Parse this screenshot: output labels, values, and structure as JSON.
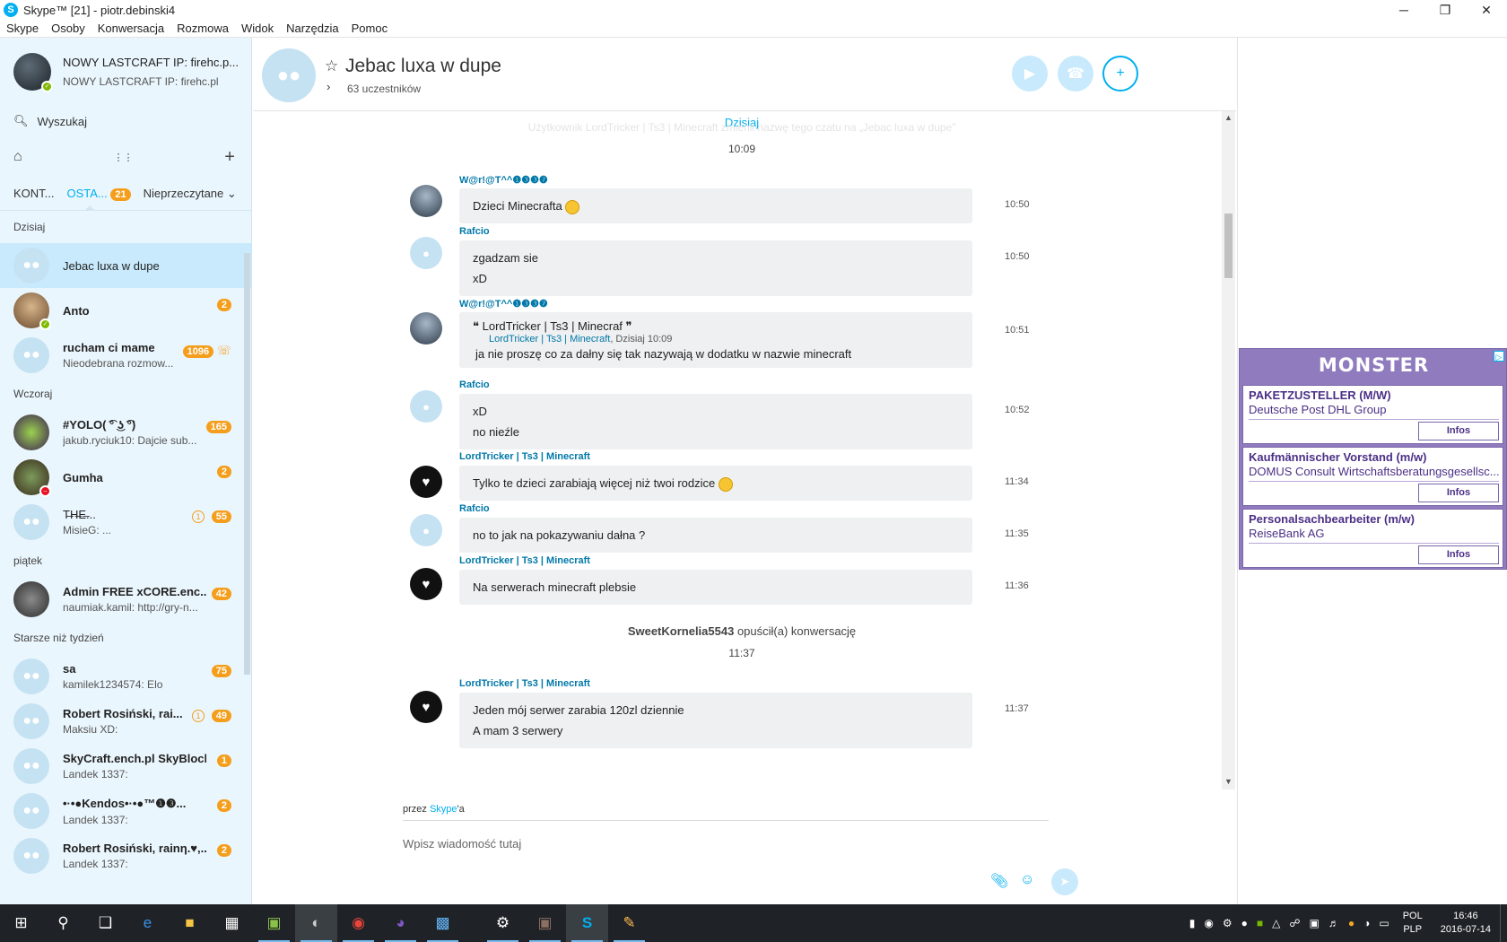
{
  "window": {
    "title": "Skype™ [21] - piotr.debinski4",
    "minimize": "─",
    "maximize": "❐",
    "close": "✕"
  },
  "menu": [
    "Skype",
    "Osoby",
    "Konwersacja",
    "Rozmowa",
    "Widok",
    "Narzędzia",
    "Pomoc"
  ],
  "profile": {
    "name": "NOWY LASTCRAFT IP: firehc.p...",
    "mood": "NOWY LASTCRAFT IP: firehc.pl"
  },
  "search": {
    "placeholder": "Wyszukaj"
  },
  "tabs": {
    "contacts": "KONT...",
    "recent": "OSTA...",
    "recent_badge": "21",
    "filter": "Nieprzeczytane"
  },
  "sections": {
    "today": "Dzisiaj",
    "yesterday": "Wczoraj",
    "friday": "piątek",
    "older": "Starsze niż tydzień"
  },
  "conversations": [
    {
      "name": "Jebac luxa w dupe",
      "sub": "",
      "badge": ""
    },
    {
      "name": "Anto",
      "sub": "",
      "badge": "2"
    },
    {
      "name": "rucham ci mame",
      "sub": "Nieodebrana rozmow...",
      "badge": "1096"
    },
    {
      "name": "#YOLO( ͡° ͜ʖ ͡°)",
      "sub": "jakub.ryciuk10: Dajcie sub...",
      "badge": "165"
    },
    {
      "name": "Gumha",
      "sub": "",
      "badge": "2"
    },
    {
      "name": "T̶H̶E̶...",
      "sub": "MisieG: ...",
      "badge": "55",
      "extra": "1"
    },
    {
      "name": "Admin FREE xCORE.enc...",
      "sub": "naumiak.kamil: http://gry-n...",
      "badge": "42"
    },
    {
      "name": "sa",
      "sub": "kamilek1234574: Elo",
      "badge": "75"
    },
    {
      "name": "Robert Rosiński, rai...",
      "sub": "Maksiu XD:",
      "badge": "49",
      "extra": "1"
    },
    {
      "name": "SkyCraft.ench.pl SkyBlock",
      "sub": "Landek 1337:",
      "badge": "1"
    },
    {
      "name": "•·•●Kendos•·•●™❶❸...",
      "sub": "Landek 1337:",
      "badge": "2"
    },
    {
      "name": "Robert Rosiński, rainη.♥,...",
      "sub": "Landek 1337:",
      "badge": "2"
    }
  ],
  "header": {
    "title": "Jebac luxa w dupe",
    "participants": "63 uczestników"
  },
  "chat": {
    "day": "Dzisiaj",
    "ghost": "Użytkownik LordTricker | Ts3 | Minecraft zmienił nazwę tego czatu na „Jebac luxa w dupe”",
    "first_time": "10:09",
    "messages": [
      {
        "sender": "W@r!@T^^❶❸❸❼",
        "lines": [
          "Dzieci Minecrafta"
        ],
        "time": "10:50"
      },
      {
        "sender": "Rafcio",
        "lines": [
          "zgadzam sie",
          "xD"
        ],
        "time": "10:50"
      },
      {
        "sender": "W@r!@T^^❶❸❸❼",
        "quote_title": "LordTricker | Ts3 | Minecraf",
        "quote_source": "LordTricker | Ts3 | Minecraft",
        "quote_when": ", Dzisiaj 10:09",
        "lines": [
          "ja nie proszę co za dałny się tak nazywają w dodatku w nazwie minecraft"
        ],
        "time": "10:51"
      },
      {
        "sender": "Rafcio",
        "lines": [
          "xD",
          "no nieźle"
        ],
        "time": "10:52"
      },
      {
        "sender": "LordTricker | Ts3 | Minecraft",
        "lines": [
          "Tylko te dzieci zarabiają więcej niż twoi rodzice"
        ],
        "time": "11:34"
      },
      {
        "sender": "Rafcio",
        "lines": [
          "no to jak na pokazywaniu dałna ?"
        ],
        "time": "11:35"
      },
      {
        "sender": "LordTricker | Ts3 | Minecraft",
        "lines": [
          "Na serwerach minecraft plebsie"
        ],
        "time": "11:36"
      },
      {
        "sender": "LordTricker | Ts3 | Minecraft",
        "lines": [
          "Jeden mój serwer zarabia 120zl dziennie",
          "A mam 3 serwery"
        ],
        "time": "11:37"
      }
    ],
    "left_user": "SweetKornelia5543",
    "left_text": " opuścił(a) konwersację",
    "left_time": "11:37"
  },
  "compose": {
    "via_prefix": "przez ",
    "via_link": "Skype",
    "via_suffix": "'a",
    "placeholder": "Wpisz wiadomość tutaj"
  },
  "ad": {
    "brand": "MONSTER",
    "jobs": [
      {
        "title": "PAKETZUSTELLER (M/W)",
        "company": "Deutsche Post DHL Group",
        "button": "Infos"
      },
      {
        "title": "Kaufmännischer Vorstand (m/w)",
        "company": "DOMUS Consult Wirtschaftsberatungsgesellsc...",
        "button": "Infos"
      },
      {
        "title": "Personalsachbearbeiter (m/w)",
        "company": "ReiseBank AG",
        "button": "Infos"
      }
    ]
  },
  "taskbar": {
    "lang_top": "POL",
    "lang_bottom": "PLP",
    "time": "16:46",
    "date": "2016-07-14"
  },
  "colors": {
    "skype_blue": "#00aff0",
    "badge_orange": "#f59e1b",
    "sidebar_bg": "#eaf6fd",
    "ad_purple": "#8f7bbd"
  }
}
